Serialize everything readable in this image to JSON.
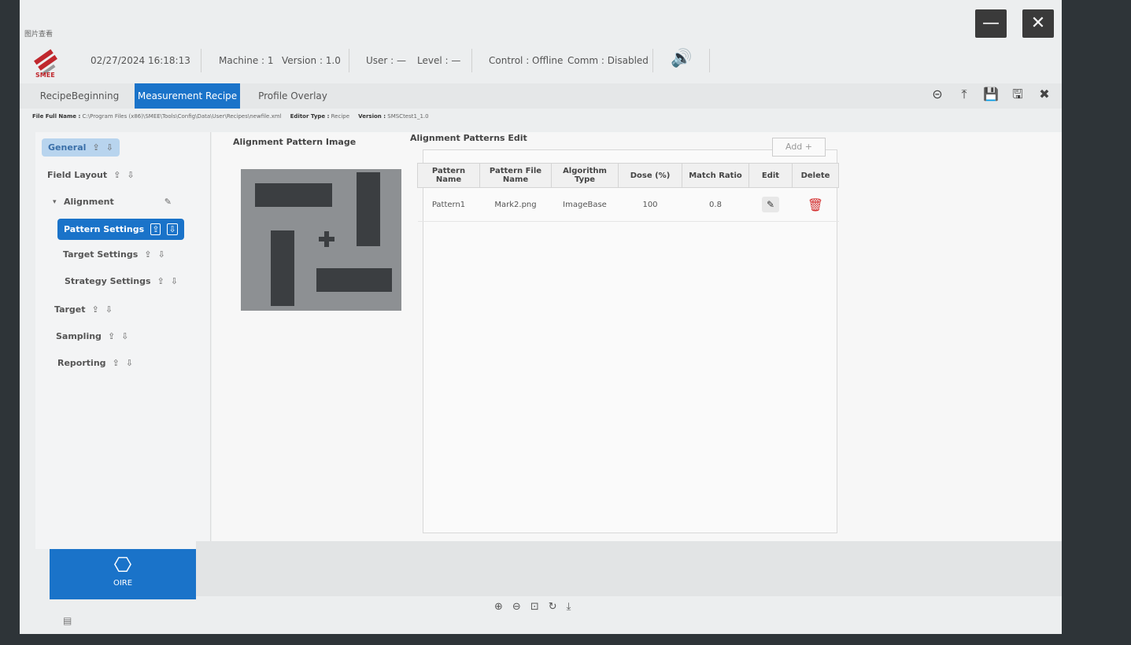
{
  "window": {
    "viewer_title": "图片查看",
    "minimize": "—",
    "close": "✕"
  },
  "status": {
    "logo_text": "SMEE",
    "datetime": "02/27/2024  16:18:13",
    "machine": "Machine : 1",
    "version": "Version : 1.0",
    "user": "User : —",
    "level": "Level : —",
    "control": "Control : Offline",
    "comm": "Comm : Disabled",
    "speaker_icon": "🔊"
  },
  "tabs": [
    "RecipeBeginning",
    "Measurement Recipe",
    "Profile Overlay"
  ],
  "toolbar_icons": [
    "⊝",
    "⤒",
    "💾",
    "🖫",
    "✖"
  ],
  "file_info": {
    "file_label": "File Full Name :",
    "file_path": "C:\\Program Files (x86)\\SMEE\\Tools\\Config\\Data\\User\\Recipes\\newfile.xml",
    "editor_label": "Editor Type :",
    "editor_value": "Recipe",
    "version_label": "Version :",
    "version_value": "SMSCtest1_1.0"
  },
  "sidebar": {
    "general": "General",
    "field_layout": "Field Layout",
    "alignment": "Alignment",
    "pattern_settings": "Pattern Settings",
    "target_settings": "Target Settings",
    "strategy_settings": "Strategy Settings",
    "target": "Target",
    "sampling": "Sampling",
    "reporting": "Reporting",
    "icons": {
      "upload": "⇪",
      "download": "⇩",
      "edit": "✎",
      "collapse": "▾"
    },
    "oire_label": "OIRE",
    "oire_icon": "⎔"
  },
  "main": {
    "image_heading": "Alignment Pattern Image",
    "edit_heading": "Alignment Patterns Edit",
    "add_button": "Add +",
    "columns": [
      "Pattern Name",
      "Pattern File Name",
      "Algorithm Type",
      "Dose (%)",
      "Match Ratio",
      "Edit",
      "Delete"
    ],
    "rows": [
      {
        "name": "Pattern1",
        "file": "Mark2.png",
        "algorithm": "ImageBase",
        "dose": "100",
        "match": "0.8"
      }
    ],
    "edit_icon": "✎",
    "delete_icon": "🗑"
  },
  "zoom_tools": [
    "⊕",
    "⊖",
    "⊡",
    "↻",
    "⤓"
  ],
  "corner_icon": "▤",
  "colors": {
    "accent": "#1a73c9",
    "delete": "#d32f2f"
  }
}
